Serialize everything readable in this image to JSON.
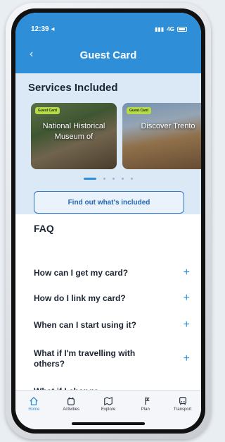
{
  "status_bar": {
    "time": "12:39 ◂",
    "network": "4G"
  },
  "header": {
    "title": "Guest Card",
    "back_icon": "chevron-left-icon"
  },
  "services": {
    "heading": "Services Included",
    "cards": [
      {
        "badge": "Guest Card",
        "title": "National Historical Museum of"
      },
      {
        "badge": "Guest Card",
        "title": "Discover Trento"
      }
    ],
    "carousel_page": 1,
    "carousel_count": 5,
    "button_label": "Find out what's included"
  },
  "faq": {
    "heading": "FAQ",
    "items": [
      {
        "question": "How can I get my card?"
      },
      {
        "question": "How do I link my card?"
      },
      {
        "question": "When can I start using it?"
      },
      {
        "question": "What if I'm travelling with others?"
      },
      {
        "question": "What if I change"
      }
    ]
  },
  "tabbar": {
    "items": [
      {
        "label": "Home",
        "icon": "home-icon",
        "active": true
      },
      {
        "label": "Activities",
        "icon": "activities-icon",
        "active": false
      },
      {
        "label": "Explore",
        "icon": "explore-icon",
        "active": false
      },
      {
        "label": "Plan",
        "icon": "plan-icon",
        "active": false
      },
      {
        "label": "Transport",
        "icon": "transport-icon",
        "active": false
      }
    ]
  },
  "colors": {
    "accent": "#2e8fd8",
    "services_bg": "#dbe8f6",
    "badge": "#b5db4a"
  }
}
